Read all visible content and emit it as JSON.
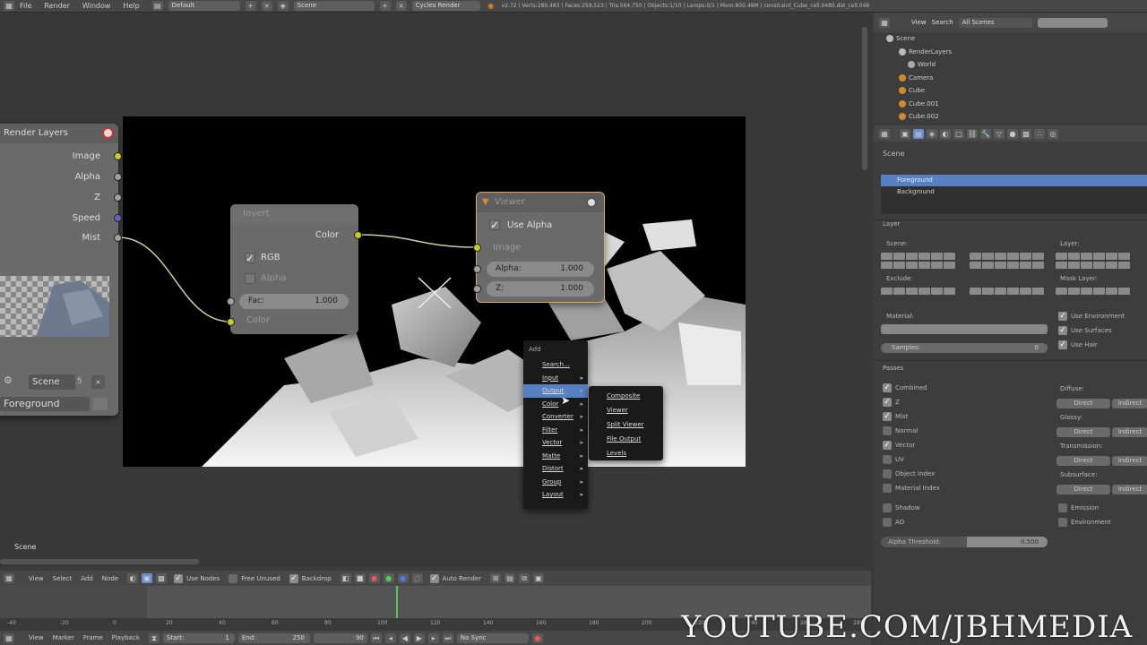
{
  "topbar": {
    "menus": [
      "File",
      "Render",
      "Window",
      "Help"
    ],
    "screen": "Default",
    "scene": "Scene",
    "engine": "Cycles Render",
    "stats": "v2.72 | Verts:289,483 | Faces:259,523 | Tris:564,750 | Objects:1/10 | Lamps:0/1 | Mem:800.48M | constraint_Cube_cell.0480.dat_cell.048"
  },
  "render_layers_node": {
    "title": "Render Layers",
    "outputs": [
      "Image",
      "Alpha",
      "Z",
      "Speed",
      "Mist"
    ],
    "scene": "Scene",
    "scene_count": "5",
    "layer": "Foreground"
  },
  "invert_node": {
    "title": "Invert",
    "output": "Color",
    "rgb": "RGB",
    "alpha": "Alpha",
    "fac_label": "Fac:",
    "fac_value": "1.000",
    "input": "Color"
  },
  "viewer_node": {
    "title": "Viewer",
    "use_alpha": "Use Alpha",
    "image": "Image",
    "alpha_label": "Alpha:",
    "alpha_value": "1.000",
    "z_label": "Z:",
    "z_value": "1.000"
  },
  "add_menu": {
    "title": "Add",
    "items": [
      {
        "label": "Search...",
        "arrow": ""
      },
      {
        "label": "Input",
        "arrow": "▸"
      },
      {
        "label": "Output",
        "arrow": "▸"
      },
      {
        "label": "Color",
        "arrow": "▸"
      },
      {
        "label": "Converter",
        "arrow": "▸"
      },
      {
        "label": "Filter",
        "arrow": "▸"
      },
      {
        "label": "Vector",
        "arrow": "▸"
      },
      {
        "label": "Matte",
        "arrow": "▸"
      },
      {
        "label": "Distort",
        "arrow": "▸"
      },
      {
        "label": "Group",
        "arrow": "▸"
      },
      {
        "label": "Layout",
        "arrow": "▸"
      }
    ],
    "active": "Output"
  },
  "output_submenu": [
    "Composite",
    "Viewer",
    "Split Viewer",
    "File Output",
    "Levels"
  ],
  "scene_label": "Scene",
  "outliner": {
    "view": "View",
    "search": "Search",
    "filter": "All Scenes",
    "rows": [
      "Scene",
      "RenderLayers",
      "World",
      "Camera",
      "Cube",
      "Cube.001",
      "Cube.002"
    ]
  },
  "properties": {
    "scene": "Scene",
    "layers": [
      "Foreground",
      "Background"
    ],
    "layer_panel": "Layer",
    "scene_lbl": "Scene:",
    "layer_lbl": "Layer:",
    "exclude": "Exclude:",
    "mask_layer": "Mask Layer:",
    "material": "Material:",
    "samples": "Samples:",
    "samples_val": "0",
    "use_env": "Use Environment",
    "use_surf": "Use Surfaces",
    "use_hair": "Use Hair",
    "passes": "Passes",
    "pass_list": [
      {
        "label": "Combined",
        "on": true
      },
      {
        "label": "Z",
        "on": true
      },
      {
        "label": "Mist",
        "on": true
      },
      {
        "label": "Normal",
        "on": false
      },
      {
        "label": "Vector",
        "on": true
      },
      {
        "label": "UV",
        "on": false
      },
      {
        "label": "Object Index",
        "on": false
      },
      {
        "label": "Material Index",
        "on": false
      },
      {
        "label": "Shadow",
        "on": false
      },
      {
        "label": "AO",
        "on": false
      }
    ],
    "right_groups": [
      "Diffuse:",
      "Glossy:",
      "Transmission:",
      "Subsurface:"
    ],
    "direct": "Direct",
    "indirect": "Indirect",
    "emission": "Emission",
    "environment": "Environment",
    "alpha_threshold": "Alpha Threshold:",
    "alpha_val": "0.500"
  },
  "node_header": {
    "menus": [
      "View",
      "Select",
      "Add",
      "Node"
    ],
    "use_nodes": "Use Nodes",
    "free_unused": "Free Unused",
    "backdrop": "Backdrop",
    "auto_render": "Auto Render"
  },
  "timeline_header": {
    "menus": [
      "View",
      "Marker",
      "Frame",
      "Playback"
    ],
    "start": "Start:",
    "start_val": "1",
    "end": "End:",
    "end_val": "250",
    "frame_val": "90",
    "sync": "No Sync"
  },
  "ruler": [
    "-40",
    "-20",
    "0",
    "20",
    "40",
    "60",
    "80",
    "100",
    "120",
    "140",
    "160",
    "180",
    "200",
    "220",
    "240",
    "260",
    "280"
  ],
  "watermark": "YOUTUBE.COM/JBHMEDIA"
}
